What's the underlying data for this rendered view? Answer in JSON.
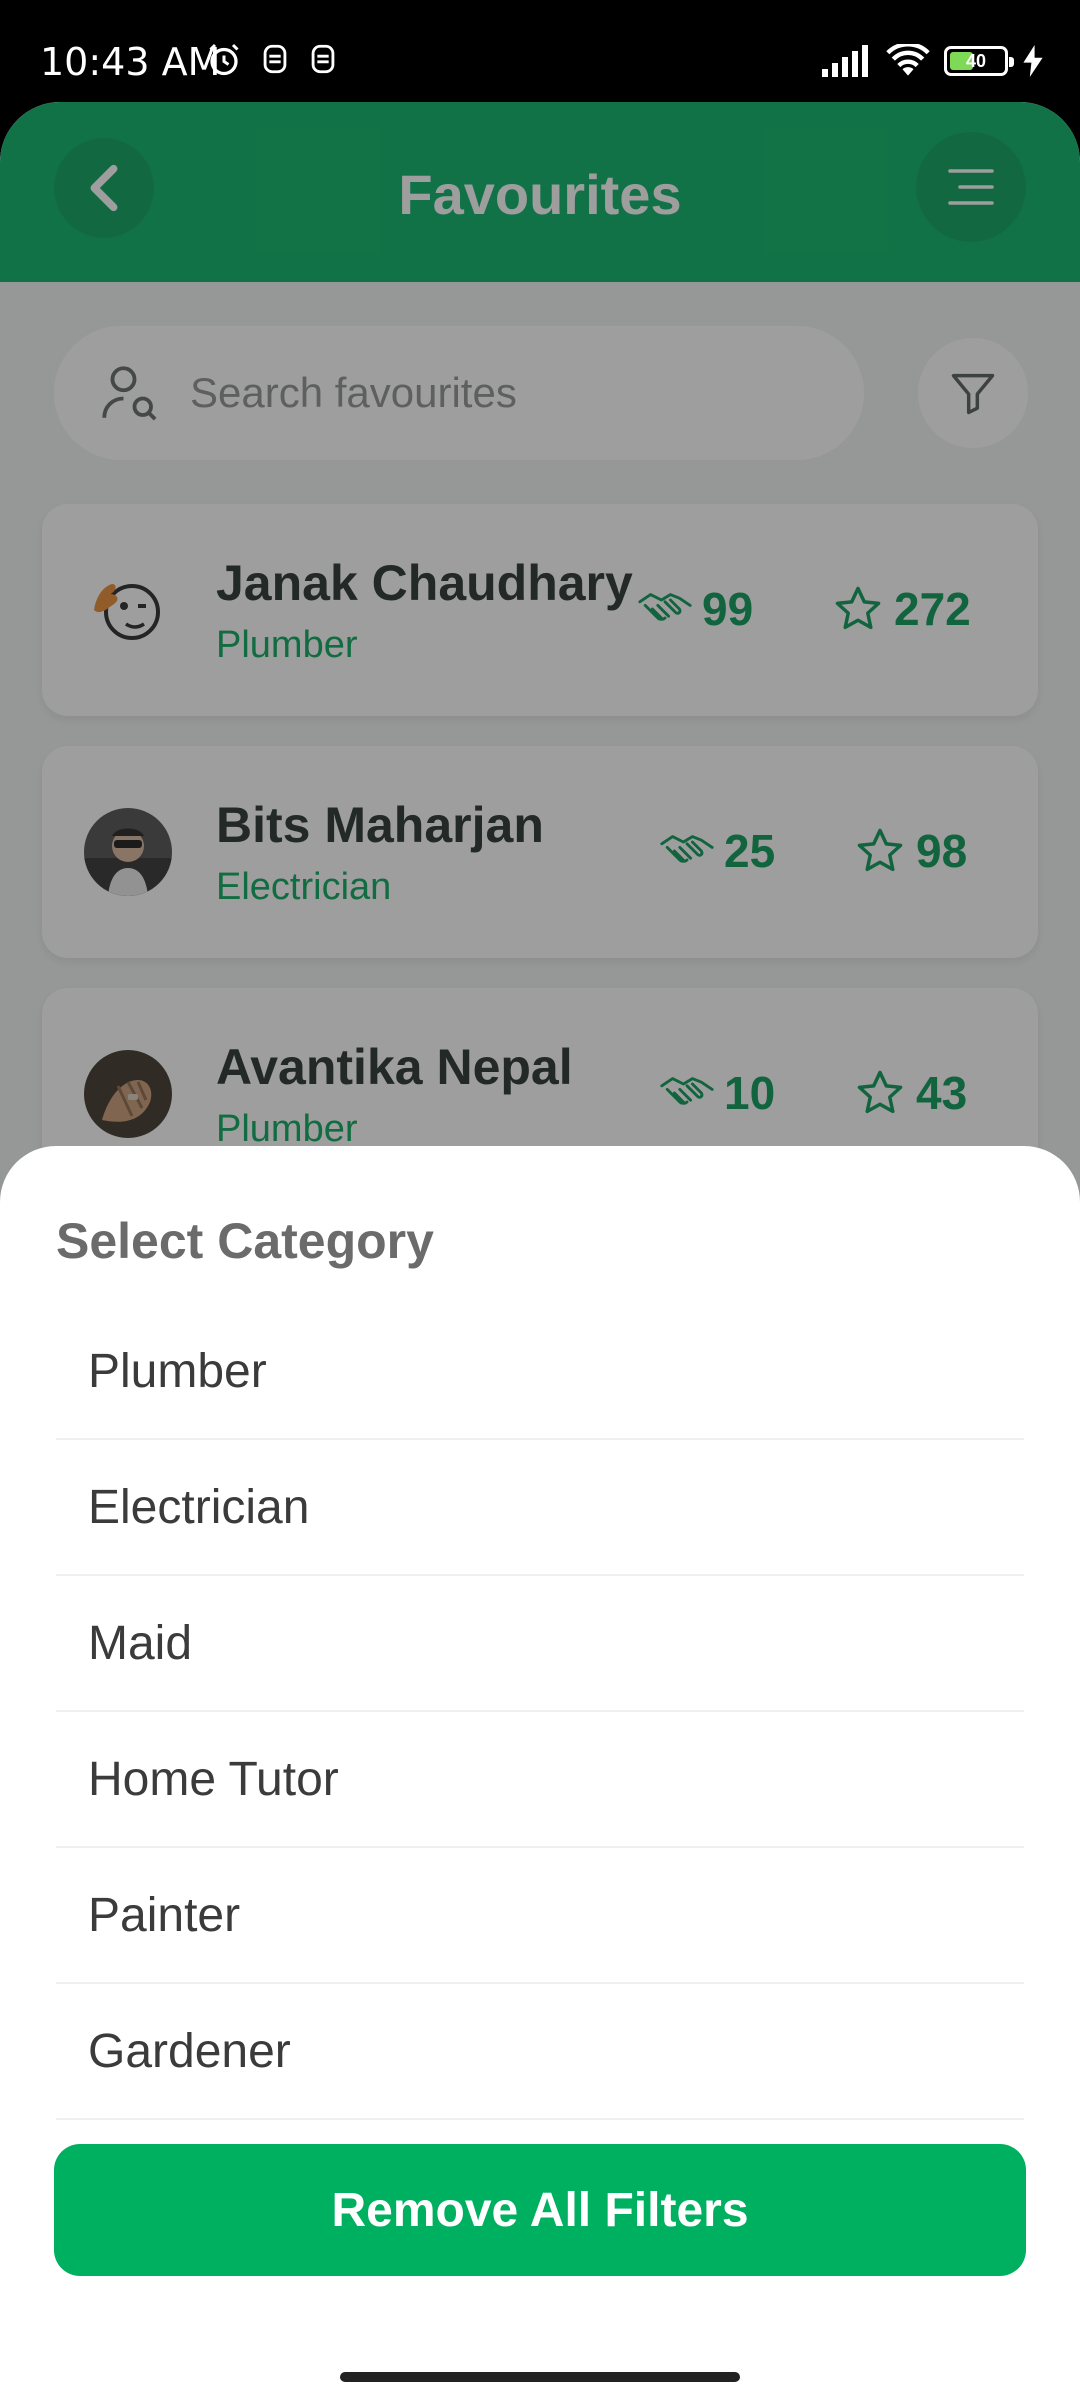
{
  "status_bar": {
    "time": "10:43 AM",
    "battery": "40"
  },
  "header": {
    "title": "Favourites"
  },
  "search": {
    "placeholder": "Search favourites"
  },
  "favourites": [
    {
      "name": "Janak Chaudhary",
      "role": "Plumber",
      "deals": "99",
      "rating": "272"
    },
    {
      "name": "Bits Maharjan",
      "role": "Electrician",
      "deals": "25",
      "rating": "98"
    },
    {
      "name": "Avantika Nepal",
      "role": "Plumber",
      "deals": "10",
      "rating": "43"
    }
  ],
  "sheet": {
    "title": "Select Category",
    "options": [
      "Plumber",
      "Electrician",
      "Maid",
      "Home Tutor",
      "Painter",
      "Gardener"
    ],
    "remove_label": "Remove All Filters"
  },
  "colors": {
    "brand": "#00b061",
    "accent_text": "#00a558"
  }
}
